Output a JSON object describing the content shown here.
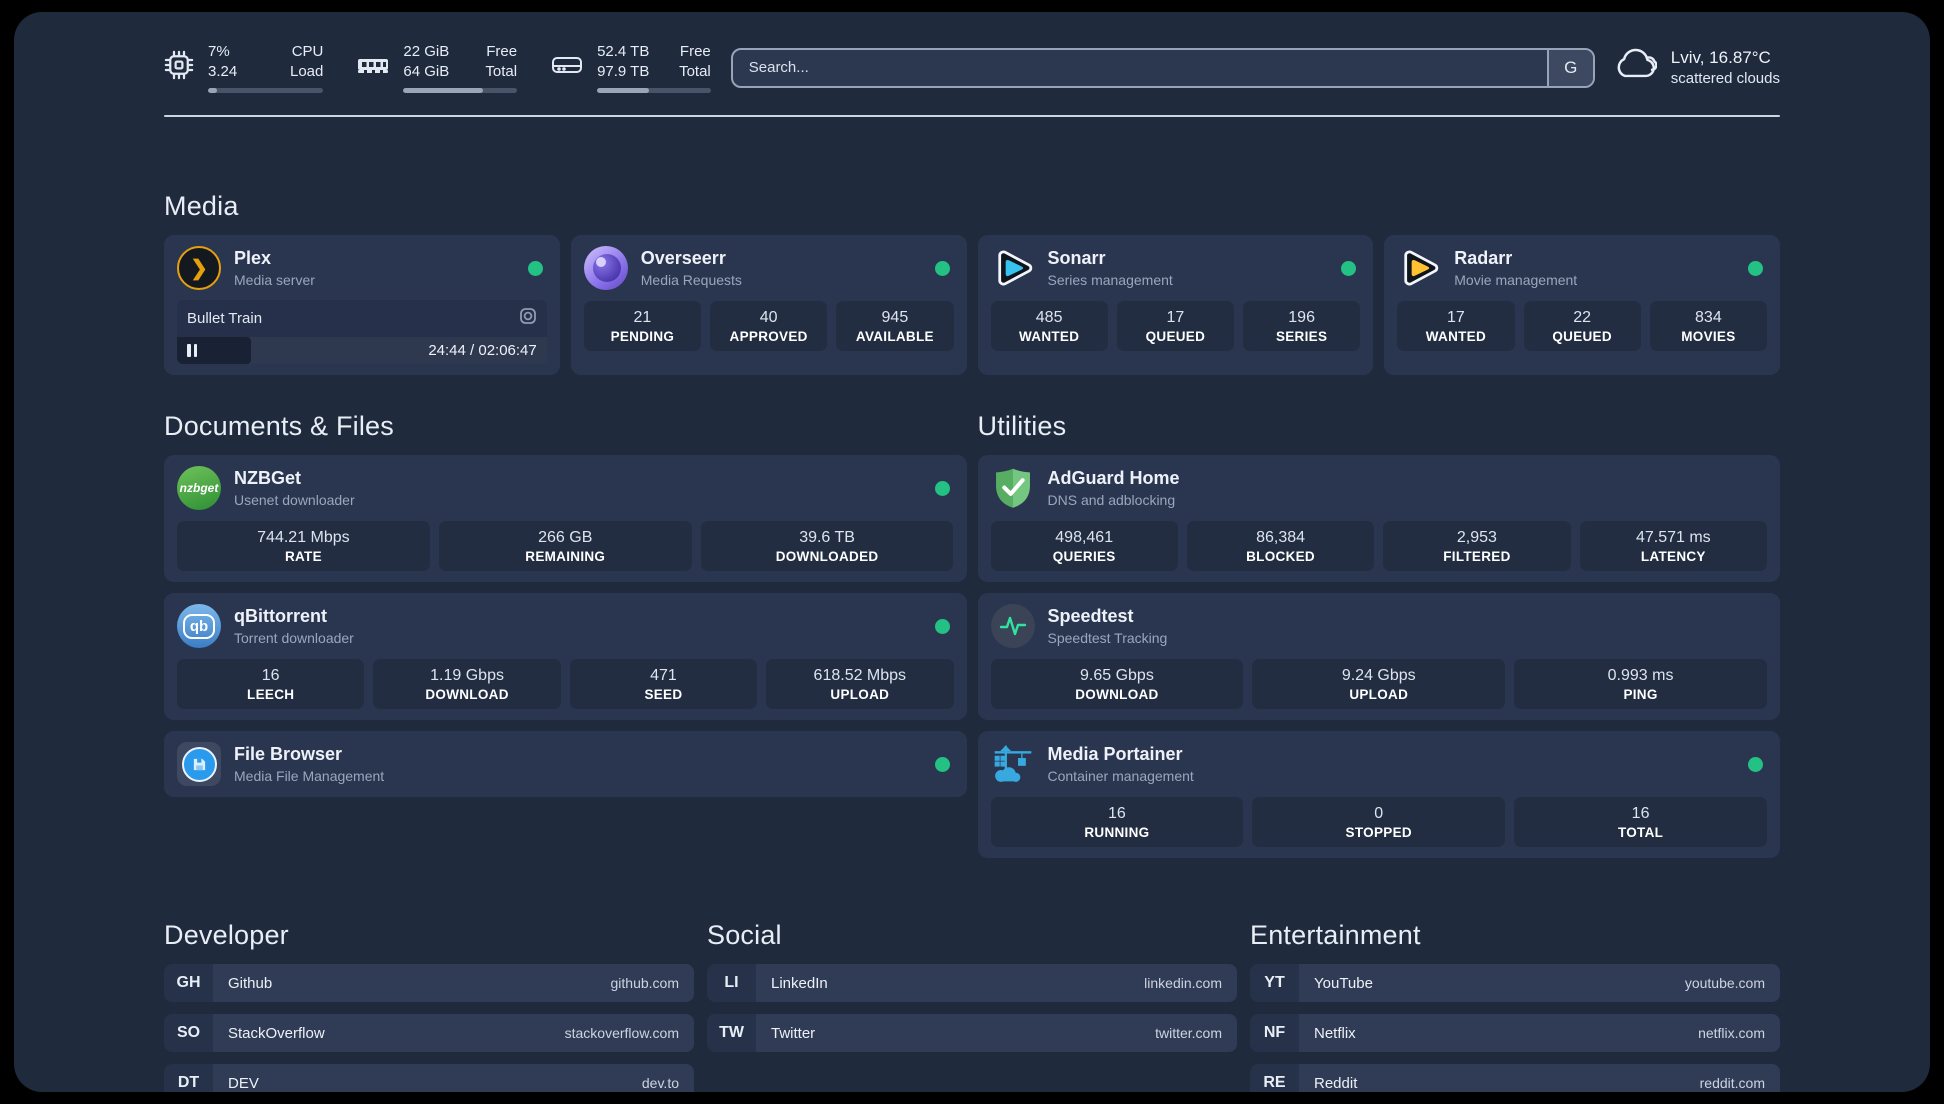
{
  "header": {
    "stats": [
      {
        "v1": "7%",
        "v2": "3.24",
        "l1": "CPU",
        "l2": "Load",
        "pct": 8
      },
      {
        "v1": "22 GiB",
        "v2": "64 GiB",
        "l1": "Free",
        "l2": "Total",
        "pct": 70
      },
      {
        "v1": "52.4 TB",
        "v2": "97.9 TB",
        "l1": "Free",
        "l2": "Total",
        "pct": 46
      }
    ],
    "search": {
      "placeholder": "Search...",
      "engine": "G"
    },
    "weather": {
      "title": "Lviv, 16.87°C",
      "subtitle": "scattered clouds"
    }
  },
  "sections": {
    "media": "Media",
    "documents": "Documents & Files",
    "utilities": "Utilities",
    "developer": "Developer",
    "social": "Social",
    "entertainment": "Entertainment"
  },
  "apps": {
    "plex": {
      "name": "Plex",
      "subtitle": "Media server",
      "player": {
        "title": "Bullet Train",
        "time": "24:44 / 02:06:47",
        "elapsed_pct": 20
      }
    },
    "overseerr": {
      "name": "Overseerr",
      "subtitle": "Media Requests",
      "stats": [
        {
          "value": "21",
          "label": "PENDING"
        },
        {
          "value": "40",
          "label": "APPROVED"
        },
        {
          "value": "945",
          "label": "AVAILABLE"
        }
      ]
    },
    "sonarr": {
      "name": "Sonarr",
      "subtitle": "Series management",
      "stats": [
        {
          "value": "485",
          "label": "WANTED"
        },
        {
          "value": "17",
          "label": "QUEUED"
        },
        {
          "value": "196",
          "label": "SERIES"
        }
      ]
    },
    "radarr": {
      "name": "Radarr",
      "subtitle": "Movie management",
      "stats": [
        {
          "value": "17",
          "label": "WANTED"
        },
        {
          "value": "22",
          "label": "QUEUED"
        },
        {
          "value": "834",
          "label": "MOVIES"
        }
      ]
    },
    "nzbget": {
      "name": "NZBGet",
      "subtitle": "Usenet downloader",
      "icon_text": "nzbget",
      "stats": [
        {
          "value": "744.21 Mbps",
          "label": "RATE"
        },
        {
          "value": "266 GB",
          "label": "REMAINING"
        },
        {
          "value": "39.6 TB",
          "label": "DOWNLOADED"
        }
      ]
    },
    "qbittorrent": {
      "name": "qBittorrent",
      "subtitle": "Torrent downloader",
      "icon_text": "qb",
      "stats": [
        {
          "value": "16",
          "label": "LEECH"
        },
        {
          "value": "1.19 Gbps",
          "label": "DOWNLOAD"
        },
        {
          "value": "471",
          "label": "SEED"
        },
        {
          "value": "618.52 Mbps",
          "label": "UPLOAD"
        }
      ]
    },
    "filebrowser": {
      "name": "File Browser",
      "subtitle": "Media File Management"
    },
    "adguard": {
      "name": "AdGuard Home",
      "subtitle": "DNS and adblocking",
      "stats": [
        {
          "value": "498,461",
          "label": "QUERIES"
        },
        {
          "value": "86,384",
          "label": "BLOCKED"
        },
        {
          "value": "2,953",
          "label": "FILTERED"
        },
        {
          "value": "47.571 ms",
          "label": "LATENCY"
        }
      ]
    },
    "speedtest": {
      "name": "Speedtest",
      "subtitle": "Speedtest Tracking",
      "stats": [
        {
          "value": "9.65 Gbps",
          "label": "DOWNLOAD"
        },
        {
          "value": "9.24 Gbps",
          "label": "UPLOAD"
        },
        {
          "value": "0.993 ms",
          "label": "PING"
        }
      ]
    },
    "portainer": {
      "name": "Media Portainer",
      "subtitle": "Container management",
      "stats": [
        {
          "value": "16",
          "label": "RUNNING"
        },
        {
          "value": "0",
          "label": "STOPPED"
        },
        {
          "value": "16",
          "label": "TOTAL"
        }
      ]
    }
  },
  "plex_chevron": "❯",
  "links": {
    "developer": [
      {
        "abbr": "GH",
        "name": "Github",
        "domain": "github.com"
      },
      {
        "abbr": "SO",
        "name": "StackOverflow",
        "domain": "stackoverflow.com"
      },
      {
        "abbr": "DT",
        "name": "DEV",
        "domain": "dev.to"
      }
    ],
    "social": [
      {
        "abbr": "LI",
        "name": "LinkedIn",
        "domain": "linkedin.com"
      },
      {
        "abbr": "TW",
        "name": "Twitter",
        "domain": "twitter.com"
      }
    ],
    "entertainment": [
      {
        "abbr": "YT",
        "name": "YouTube",
        "domain": "youtube.com"
      },
      {
        "abbr": "NF",
        "name": "Netflix",
        "domain": "netflix.com"
      },
      {
        "abbr": "RE",
        "name": "Reddit",
        "domain": "reddit.com"
      }
    ]
  },
  "colors": {
    "status_online": "#23c183",
    "plex_accent": "#e5a00d",
    "sonarr_accent": "#36c3f1",
    "radarr_accent": "#ffc230"
  }
}
